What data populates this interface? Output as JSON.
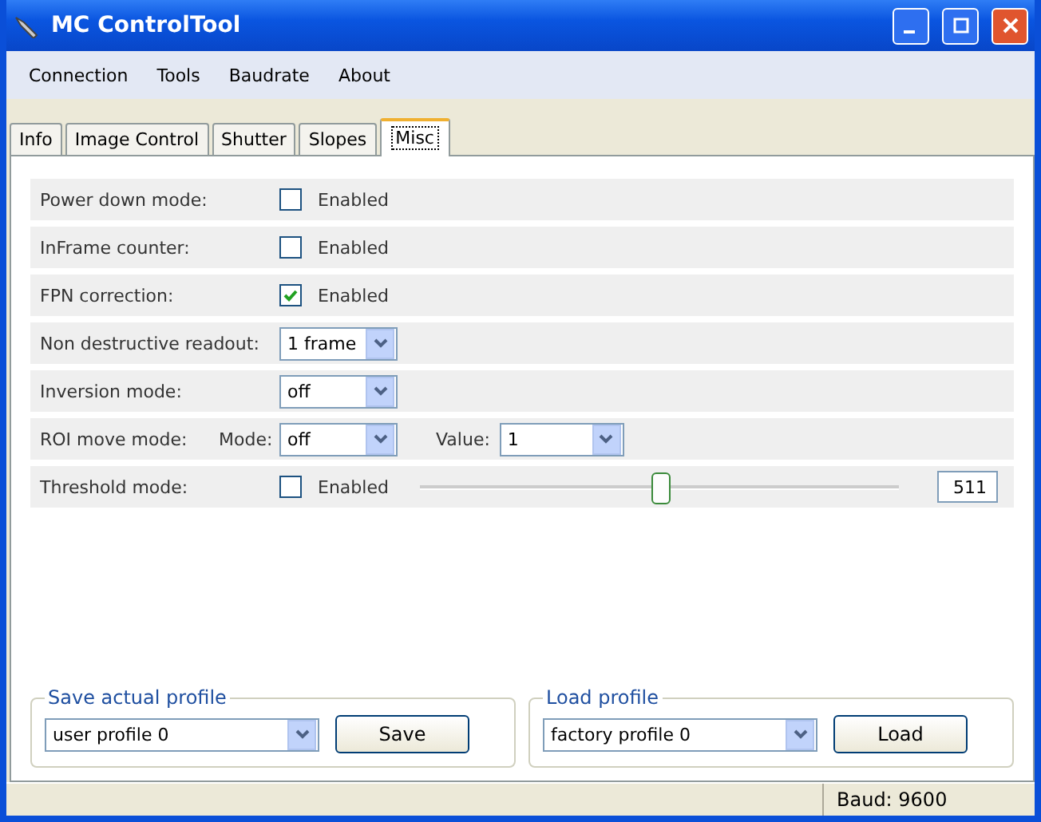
{
  "window": {
    "title": "MC ControlTool"
  },
  "menu": [
    "Connection",
    "Tools",
    "Baudrate",
    "About"
  ],
  "tabs": [
    {
      "label": "Info",
      "selected": false
    },
    {
      "label": "Image Control",
      "selected": false
    },
    {
      "label": "Shutter",
      "selected": false
    },
    {
      "label": "Slopes",
      "selected": false
    },
    {
      "label": "Misc",
      "selected": true
    }
  ],
  "rows": [
    {
      "kind": "checkbox",
      "label": "Power down mode:",
      "option": "Enabled",
      "checked": false
    },
    {
      "kind": "checkbox",
      "label": "InFrame counter:",
      "option": "Enabled",
      "checked": false
    },
    {
      "kind": "checkbox",
      "label": "FPN correction:",
      "option": "Enabled",
      "checked": true
    },
    {
      "kind": "select",
      "label": "Non destructive readout:",
      "value": "1 frame"
    },
    {
      "kind": "select",
      "label": "Inversion mode:",
      "value": "off"
    },
    {
      "kind": "roi",
      "label": "ROI move mode:",
      "mode_label": "Mode:",
      "mode_value": "off",
      "value_label": "Value:",
      "value": "1"
    },
    {
      "kind": "threshold",
      "label": "Threshold mode:",
      "option": "Enabled",
      "checked": false,
      "level": 0.5,
      "reading": "511"
    }
  ],
  "save_group": {
    "title": "Save actual profile",
    "value": "user profile 0",
    "button": "Save"
  },
  "load_group": {
    "title": "Load profile",
    "value": "factory profile 0",
    "button": "Load"
  },
  "status_bar": {
    "baud": "Baud: 9600"
  }
}
